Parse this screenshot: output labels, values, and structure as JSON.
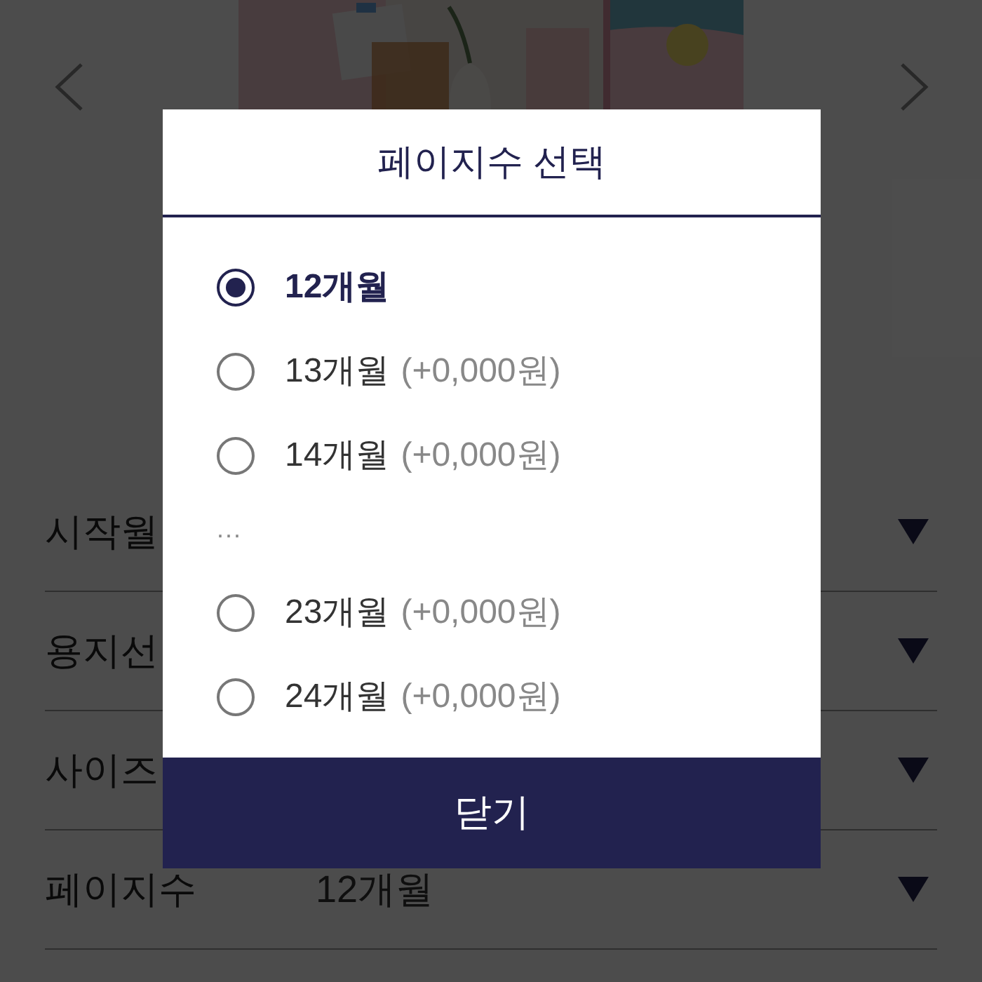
{
  "page": {
    "rows": [
      {
        "label": "시작월"
      },
      {
        "label": "용지선"
      },
      {
        "label": "사이즈"
      },
      {
        "label": "페이지수",
        "value": "12개월"
      }
    ]
  },
  "dialog": {
    "title": "페이지수 선택",
    "options": [
      {
        "label": "12개월",
        "selected": true
      },
      {
        "label": "13개월",
        "price": "(+0,000원)",
        "selected": false
      },
      {
        "label": "14개월",
        "price": "(+0,000원)",
        "selected": false
      }
    ],
    "more_indicator": "···",
    "more_options": [
      {
        "label": "23개월",
        "price": "(+0,000원)",
        "selected": false
      },
      {
        "label": "24개월",
        "price": "(+0,000원)",
        "selected": false
      }
    ],
    "close_button": "닫기"
  }
}
